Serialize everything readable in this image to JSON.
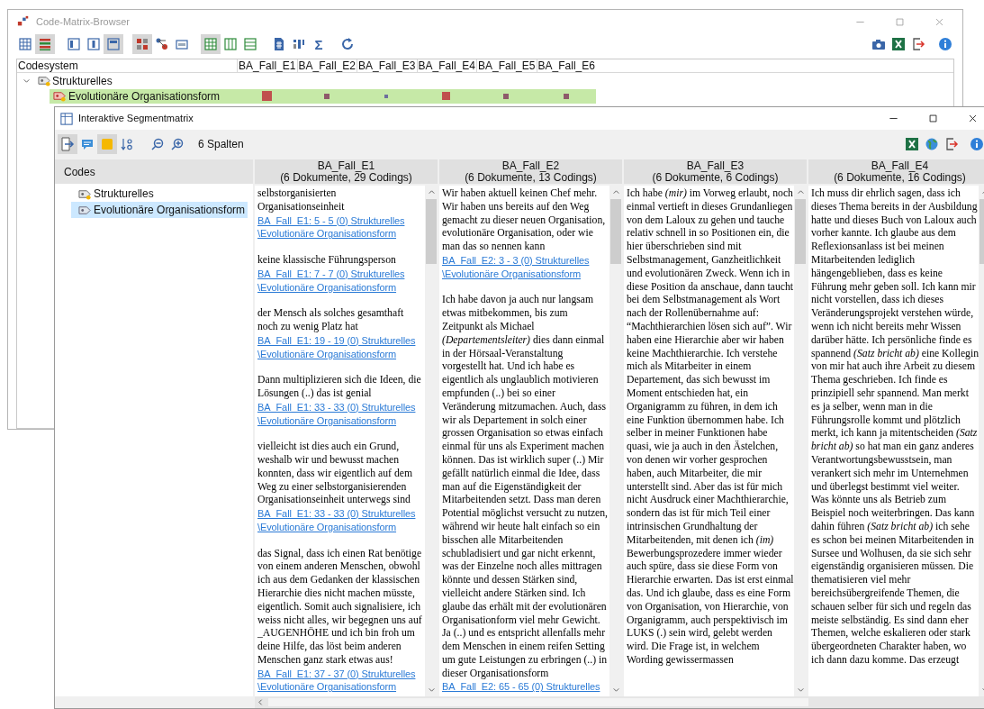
{
  "back_window": {
    "title": "Code-Matrix-Browser",
    "toolbar": [
      {
        "selected": false
      },
      {
        "selected": true
      },
      {
        "selected": false
      },
      {
        "selected": false
      },
      {
        "selected": true
      },
      {
        "selected": true
      },
      {
        "selected": false
      },
      {
        "selected": false
      },
      {
        "selected": true
      },
      {
        "selected": false
      },
      {
        "selected": false
      },
      {
        "selected": false
      },
      {
        "selected": false
      },
      {
        "label": "Σ",
        "selected": false
      },
      {
        "selected": false
      }
    ],
    "matrix": {
      "header": "Codesystem",
      "columns": [
        "BA_Fall_E1",
        "BA_Fall_E2",
        "BA_Fall_E3",
        "BA_Fall_E4",
        "BA_Fall_E5",
        "BA_Fall_E6"
      ],
      "codes": [
        {
          "label": "Strukturelles",
          "expanded": true,
          "children": [
            {
              "label": "Evolutionäre Organisationsform",
              "selected": true,
              "cells": [
                {
                  "kind": "large",
                  "color": "#c0504d"
                },
                {
                  "kind": "small",
                  "color": "#8e5a6a"
                },
                {
                  "kind": "tiny",
                  "color": "#6d6f9c"
                },
                {
                  "kind": "medium",
                  "color": "#c0504d"
                },
                {
                  "kind": "small",
                  "color": "#8e5a6a"
                },
                {
                  "kind": "small",
                  "color": "#8e5a6a"
                }
              ]
            }
          ]
        }
      ]
    }
  },
  "front_window": {
    "title": "Interaktive Segmentmatrix",
    "toolbar": [
      {
        "selected": true
      },
      {
        "selected": false
      },
      {
        "selected": true
      },
      {
        "selected": false
      },
      {
        "selected": false
      },
      {
        "selected": false
      }
    ],
    "column_count": "6 Spalten",
    "codes_panel": {
      "header": "Codes",
      "items": [
        {
          "label": "Strukturelles",
          "selected": false
        },
        {
          "label": "Evolutionäre Organisationsform",
          "selected": true
        }
      ]
    },
    "columns": [
      {
        "title": "BA_Fall_E1",
        "subtitle": "(6 Dokumente, 29 Codings)",
        "segments": [
          {
            "text": "selbstorganisierten Organisationseinheit",
            "source": "BA_Fall_E1: 5 - 5 (0) Strukturelles\\Evolutionäre Organisationsform"
          },
          {
            "text": "keine klassische Führungsperson",
            "source": "BA_Fall_E1: 7 - 7 (0) Strukturelles\\Evolutionäre Organisationsform"
          },
          {
            "text": "der Mensch als solches gesamthaft noch zu wenig Platz hat",
            "source": "BA_Fall_E1: 19 - 19 (0) Strukturelles\\Evolutionäre Organisationsform"
          },
          {
            "text": "Dann multiplizieren sich die Ideen, die Lösungen (..) das ist genial",
            "source": "BA_Fall_E1: 33 - 33 (0) Strukturelles\\Evolutionäre Organisationsform"
          },
          {
            "text": "vielleicht ist dies auch ein Grund, weshalb wir und bewusst machen konnten, dass wir eigentlich auf dem Weg zu einer selbstorganisierenden Organisationseinheit unterwegs sind",
            "source": "BA_Fall_E1: 33 - 33 (0) Strukturelles\\Evolutionäre Organisationsform"
          },
          {
            "text": "das Signal, dass ich einen Rat benötige von einem anderen Menschen, obwohl ich aus dem Gedanken der klassischen Hierarchie dies nicht machen müsste, eigentlich. Somit auch signalisiere, ich weiss nicht alles, wir begegnen uns auf _AUGENHÖHE und ich bin froh um deine Hilfe, das löst beim anderen Menschen ganz stark etwas aus!",
            "source": "BA_Fall_E1: 37 - 37 (0) Strukturelles\\Evolutionäre Organisationsform"
          }
        ]
      },
      {
        "title": "BA_Fall_E2",
        "subtitle": "(6 Dokumente, 13 Codings)",
        "segments": [
          {
            "text": "Wir haben aktuell keinen Chef mehr. Wir haben uns bereits auf den Weg gemacht zu dieser neuen Organisation, evolutionäre Organisation, oder wie man das so nennen kann",
            "source": "BA_Fall_E2: 3 - 3 (0) Strukturelles\\Evolutionäre Organisationsform"
          },
          {
            "text": "Ich habe davon ja auch nur langsam etwas mitbekommen, bis zum Zeitpunkt als Michael *(Departementsleiter)* dies dann einmal in der Hörsaal-Veranstaltung vorgestellt hat. Und ich habe es eigentlich als unglaublich motivieren empfunden (..) bei so einer Veränderung mitzumachen. Auch, dass wir als Departement in solch einer grossen Organisation so etwas einfach einmal für uns als Experiment machen können. Das ist wirklich super (..) Mir gefällt natürlich einmal die Idee, dass man auf die Eigenständigkeit der Mitarbeitenden setzt. Dass man deren Potential möglichst versucht zu nutzen, während wir heute halt einfach so ein bisschen alle Mitarbeitenden schubladisiert und gar nicht erkennt, was der Einzelne noch alles mittragen könnte und dessen Stärken sind, vielleicht andere Stärken sind. Ich glaube das erhält mit der evolutionären Organisationform viel mehr Gewicht. Ja (..) und es entspricht allenfalls mehr dem Menschen in einem reifen Setting um gute Leistungen zu erbringen (..) in dieser Organisationsform",
            "source": "BA_Fall_E2: 65 - 65 (0) Strukturelles"
          }
        ]
      },
      {
        "title": "BA_Fall_E3",
        "subtitle": "(6 Dokumente, 6 Codings)",
        "segments": [
          {
            "text": "Ich habe *(mir)* im Vorweg erlaubt, noch einmal vertieft in dieses Grundanliegen von dem Laloux zu gehen und tauche relativ schnell in so Positionen ein, die hier überschrieben sind mit Selbstmanagement, Ganzheitlichkeit und evolutionären Zweck. Wenn ich in diese Position da anschaue, dann taucht bei dem Selbstmanagement als Wort nach der Rollenübernahme auf: “Machthierarchien lösen sich auf”. Wir haben eine Hierarchie aber wir haben keine Machthierarchie. Ich verstehe mich als Mitarbeiter in einem Departement, das sich bewusst im Moment entschieden hat, ein Organigramm zu führen, in dem ich eine Funktion übernommen habe. Ich selber in meiner Funktionen habe quasi, wie ja auch in den Ästelchen, von denen wir vorher gesprochen haben, auch Mitarbeiter, die mir unterstellt sind. Aber das ist für mich nicht Ausdruck einer Machthierarchie, sondern das ist für mich Teil einer intrinsischen Grundhaltung der Mitarbeitenden, mit denen ich *(im)* Bewerbungsprozedere immer wieder auch spüre, dass sie diese Form von Hierarchie erwarten. Das ist erst einmal das. Und ich glaube, dass es eine Form von Organisation, von Hierarchie, von Organigramm, auch perspektivisch im LUKS (.) sein wird, gelebt werden wird. Die Frage ist, in welchem Wording gewissermassen"
          }
        ]
      },
      {
        "title": "BA_Fall_E4",
        "subtitle": "(6 Dokumente, 16 Codings)",
        "segments": [
          {
            "text": "Ich muss dir ehrlich sagen, dass ich dieses Thema bereits in der Ausbildung hatte und dieses Buch von Laloux auch vorher kannte. Ich glaube aus dem Reflexionsanlass ist bei meinen Mitarbeitenden lediglich hängengeblieben, dass es keine Führung mehr geben soll. Ich kann mir nicht vorstellen, dass ich dieses Veränderungsprojekt verstehen würde, wenn ich nicht bereits mehr Wissen darüber hätte. Ich persönliche finde es spannend *(Satz bricht ab)* eine Kollegin von mir hat auch ihre Arbeit zu diesem Thema geschrieben. Ich finde es prinzipiell sehr spannend. Man merkt es ja selber, wenn man in die Führungsrolle kommt und plötzlich merkt, ich kann ja mitentscheiden *(Satz bricht ab)* so hat man ein ganz anderes Verantwortungsbewusstsein, man verankert sich mehr im Unternehmen und überlegst bestimmt viel weiter. Was könnte uns als Betrieb zum Beispiel noch weiterbringen. Das kann dahin führen *(Satz bricht ab)* ich sehe es schon bei meinen Mitarbeitenden in Sursee und Wolhusen, da sie sich sehr eigenständig organisieren müssen. Die thematisieren viel mehr bereichsübergreifende Themen, die schauen selber für sich und regeln das meiste selbständig. Es sind dann eher Themen, welche eskalieren oder stark übergeordneten Charakter haben, wo ich dann dazu komme. Das erzeugt"
          }
        ]
      }
    ]
  }
}
